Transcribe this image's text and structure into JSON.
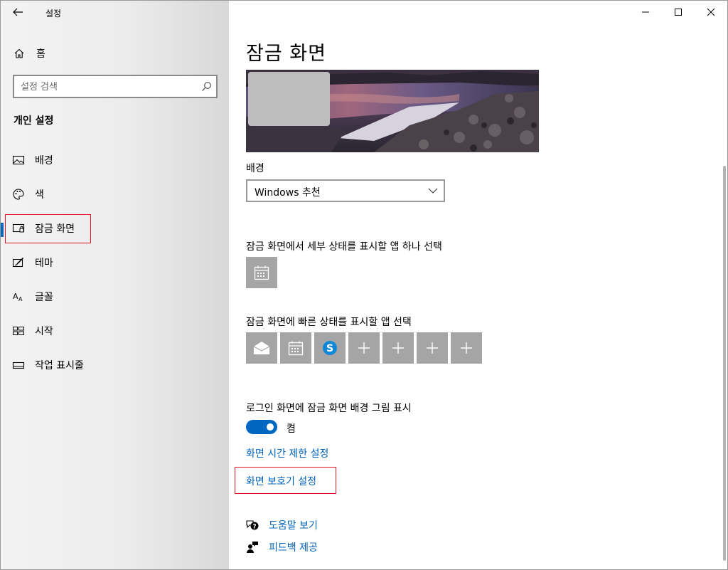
{
  "app": {
    "title": "설정"
  },
  "sidebar": {
    "home_label": "홈",
    "search_placeholder": "설정 검색",
    "section_title": "개인 설정",
    "items": [
      {
        "label": "배경",
        "icon": "picture-icon"
      },
      {
        "label": "색",
        "icon": "palette-icon"
      },
      {
        "label": "잠금 화면",
        "icon": "lock-screen-icon",
        "active": true
      },
      {
        "label": "테마",
        "icon": "theme-brush-icon"
      },
      {
        "label": "글꼴",
        "icon": "font-icon"
      },
      {
        "label": "시작",
        "icon": "start-tiles-icon"
      },
      {
        "label": "작업 표시줄",
        "icon": "taskbar-icon"
      }
    ]
  },
  "main": {
    "title": "잠금 화면",
    "background_label": "배경",
    "background_value": "Windows 추천",
    "detailed_status_label": "잠금 화면에서 세부 상태를 표시할 앱 하나 선택",
    "detailed_status_app": "calendar-icon",
    "quick_status_label": "잠금 화면에 빠른 상태를 표시할 앱 선택",
    "quick_status_apps": [
      "mail-icon",
      "calendar-icon",
      "skype-icon",
      "plus-icon",
      "plus-icon",
      "plus-icon",
      "plus-icon"
    ],
    "signin_bg_label": "로그인 화면에 잠금 화면 배경 그림 표시",
    "signin_bg_toggle": {
      "on": true,
      "state_label": "켬"
    },
    "screen_timeout_link": "화면 시간 제한 설정",
    "screensaver_link": "화면 보호기 설정",
    "help_link": "도움말 보기",
    "feedback_link": "피드백 제공"
  },
  "colors": {
    "accent": "#0067c0",
    "link": "#0062b8",
    "highlight_box": "#e81123",
    "tile": "#a5a5a5"
  }
}
